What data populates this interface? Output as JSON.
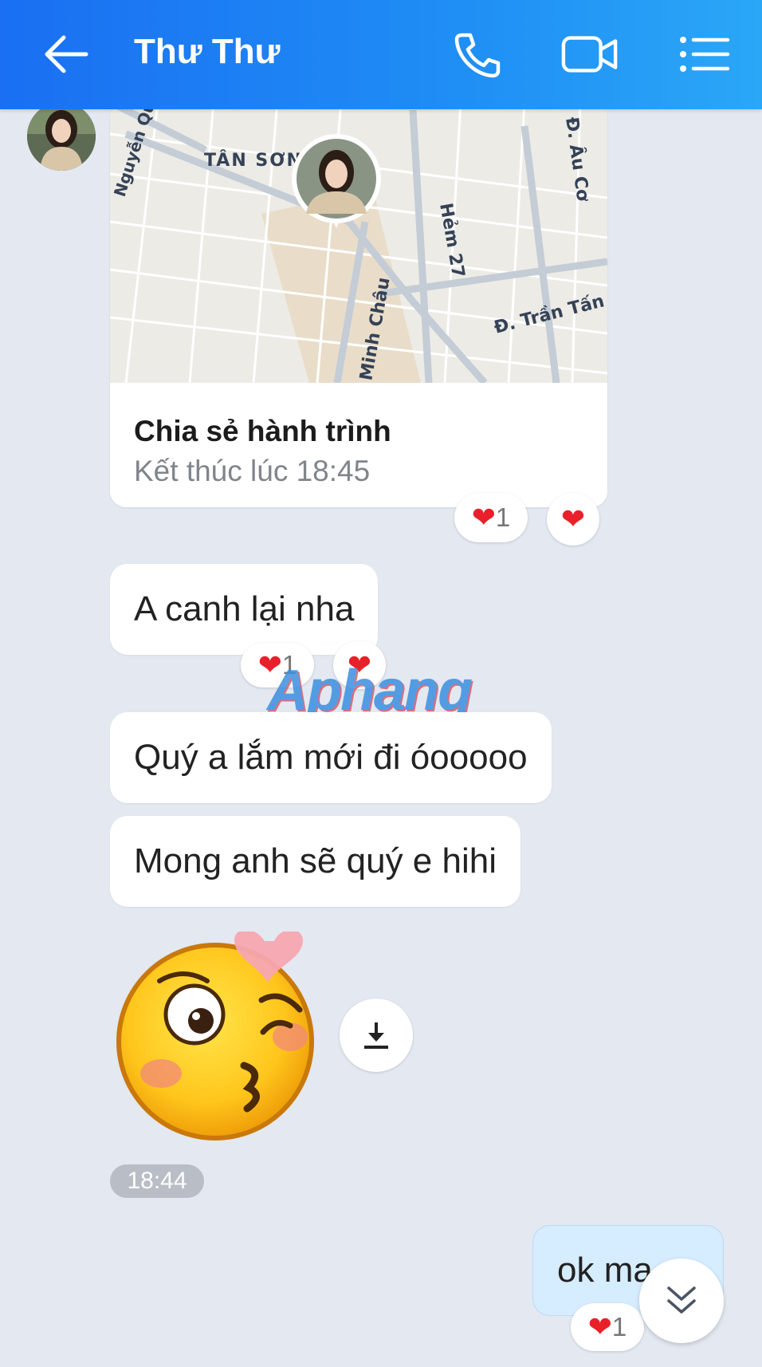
{
  "header": {
    "title": "Thư Thư",
    "icons": [
      "back-arrow-icon",
      "phone-icon",
      "video-call-icon",
      "menu-list-icon"
    ],
    "background": "#1a6ff2"
  },
  "map_card": {
    "labels": {
      "tan_son": "TÂN SƠN N",
      "nguyen": "Nguyễn Qu",
      "au_co": "Đ. Âu Cơ",
      "hem27": "Hẻm 27",
      "tran_tan": "Đ. Trần Tấn",
      "minh_chau": "Minh Châu"
    },
    "title": "Chia sẻ hành trình",
    "subtitle": "Kết thúc lúc 18:45",
    "reaction_count": "1"
  },
  "messages": [
    {
      "text": "A canh lại nha",
      "reaction_count": "1"
    },
    {
      "text": "Quý a lắm mới đi óooooo"
    },
    {
      "text": "Mong anh sẽ quý e hihi"
    }
  ],
  "watermark": "Aphang",
  "sticker": "kiss-wink-emoji-sticker",
  "timestamp": "18:44",
  "sent_message": {
    "text": "ok ma",
    "reaction_count": "1"
  },
  "reaction_heart": "❤",
  "colors": {
    "bubble_incoming": "#ffffff",
    "bubble_outgoing": "#d6ecff",
    "heart": "#e8202a",
    "background": "#e3e8f1"
  }
}
